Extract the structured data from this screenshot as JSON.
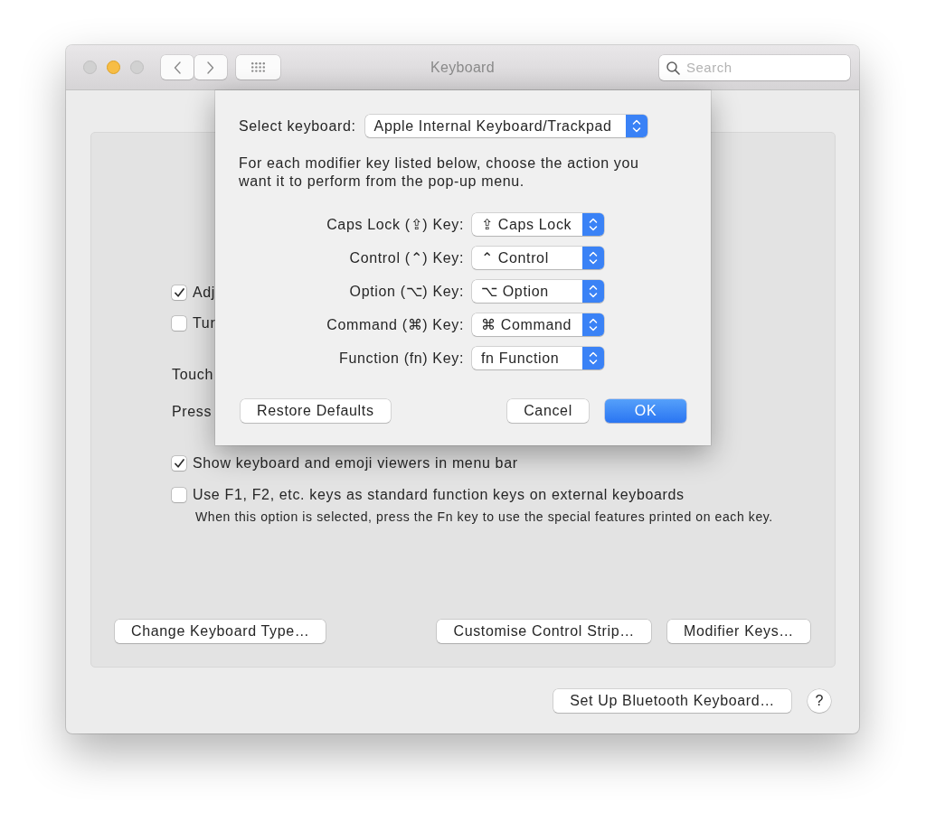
{
  "window": {
    "title": "Keyboard",
    "traffic_lights": [
      {
        "kind": "close",
        "disabled": true
      },
      {
        "kind": "minimize",
        "disabled": false
      },
      {
        "kind": "zoom",
        "disabled": true
      }
    ],
    "search": {
      "placeholder": "Search"
    }
  },
  "settings": {
    "items": [
      {
        "kind": "checkbox",
        "label": "Adj",
        "checked": true
      },
      {
        "kind": "checkbox",
        "label": "Tur",
        "checked": false
      },
      {
        "kind": "text",
        "label": "Touch"
      },
      {
        "kind": "text",
        "label": "Press"
      },
      {
        "kind": "checkbox",
        "label": "Show keyboard and emoji viewers in menu bar",
        "checked": true
      },
      {
        "kind": "checkbox",
        "label": "Use F1, F2, etc. keys as standard function keys on external keyboards",
        "checked": false,
        "note": "When this option is selected, press the Fn key to use the special features printed on each key."
      }
    ],
    "buttons": [
      "Change Keyboard Type…",
      "Customise Control Strip…",
      "Modifier Keys…"
    ]
  },
  "footer": {
    "buttons": [
      "Set Up Bluetooth Keyboard…"
    ],
    "help": "?"
  },
  "sheet": {
    "select_keyboard": {
      "label": "Select keyboard:",
      "value": "Apple Internal Keyboard/Trackpad"
    },
    "description": "For each modifier key listed below, choose the action you want it to perform from the pop-up menu.",
    "modifiers": [
      {
        "label": "Caps Lock (⇪) Key:",
        "value": "⇪ Caps Lock"
      },
      {
        "label": "Control (⌃) Key:",
        "value": "⌃ Control"
      },
      {
        "label": "Option (⌥) Key:",
        "value": "⌥ Option"
      },
      {
        "label": "Command (⌘) Key:",
        "value": "⌘ Command"
      },
      {
        "label": "Function (fn) Key:",
        "value": "fn Function"
      }
    ],
    "buttons": [
      {
        "label": "Restore Defaults",
        "kind": "normal"
      },
      {
        "label": "Cancel",
        "kind": "normal"
      },
      {
        "label": "OK",
        "kind": "default"
      }
    ]
  }
}
